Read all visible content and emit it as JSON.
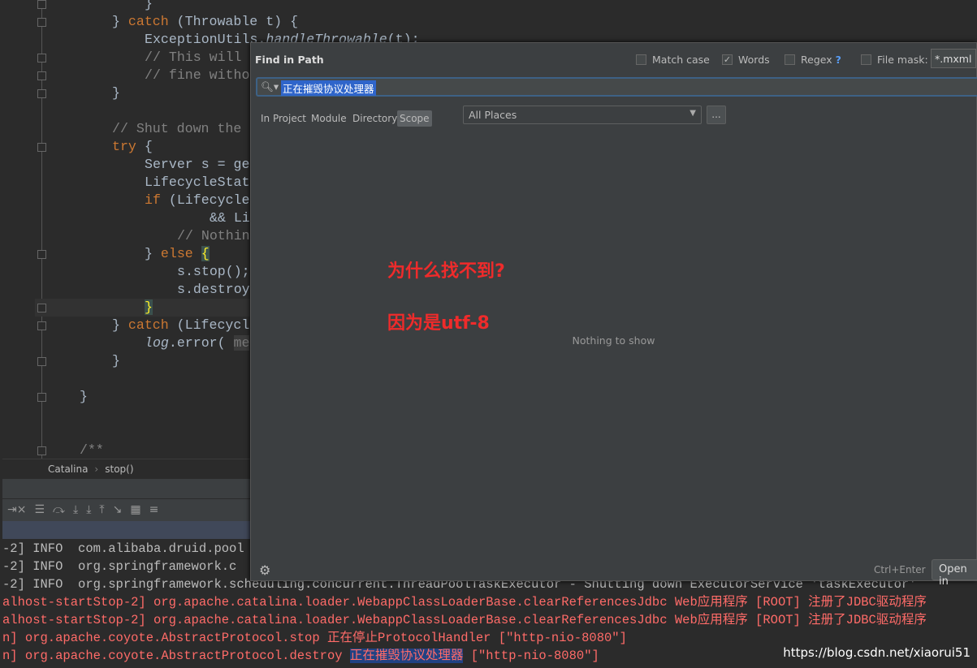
{
  "editor": {
    "lines": [
      {
        "indent": 8,
        "parts": [
          [
            "}",
            ""
          ]
        ]
      },
      {
        "indent": 4,
        "parts": [
          [
            "} ",
            ""
          ],
          [
            "catch",
            ".kw"
          ],
          [
            " (Throwable t) {",
            ""
          ]
        ]
      },
      {
        "indent": 8,
        "parts": [
          [
            "ExceptionUtils.",
            ""
          ],
          [
            "handleThrowable",
            ".it"
          ],
          [
            "(t);",
            ""
          ]
        ]
      },
      {
        "indent": 8,
        "parts": [
          [
            "// This will",
            ".cm"
          ]
        ]
      },
      {
        "indent": 8,
        "parts": [
          [
            "// fine witho",
            ".cm"
          ]
        ]
      },
      {
        "indent": 4,
        "parts": [
          [
            "}",
            ""
          ]
        ]
      },
      {
        "indent": 0,
        "parts": []
      },
      {
        "indent": 4,
        "parts": [
          [
            "// Shut down the",
            ".cm"
          ]
        ]
      },
      {
        "indent": 4,
        "parts": [
          [
            "try",
            ".kw"
          ],
          [
            " {",
            ""
          ]
        ]
      },
      {
        "indent": 8,
        "parts": [
          [
            "Server s = ge",
            ""
          ]
        ]
      },
      {
        "indent": 8,
        "parts": [
          [
            "LifecycleStat",
            ""
          ]
        ]
      },
      {
        "indent": 8,
        "parts": [
          [
            "if",
            ".kw"
          ],
          [
            " (Lifecycle",
            ""
          ]
        ]
      },
      {
        "indent": 16,
        "parts": [
          [
            "&& Li",
            ""
          ]
        ]
      },
      {
        "indent": 12,
        "parts": [
          [
            "// Nothin",
            ".cm"
          ]
        ]
      },
      {
        "indent": 8,
        "parts": [
          [
            "} ",
            ""
          ],
          [
            "else",
            ".kw"
          ],
          [
            " ",
            ""
          ],
          [
            "{",
            ".brace-match"
          ]
        ]
      },
      {
        "indent": 12,
        "parts": [
          [
            "s.stop();",
            ""
          ]
        ]
      },
      {
        "indent": 12,
        "parts": [
          [
            "s.destroy",
            ""
          ]
        ]
      },
      {
        "indent": 8,
        "parts": [
          [
            "}",
            ".brace-match"
          ]
        ],
        "current": true
      },
      {
        "indent": 4,
        "parts": [
          [
            "} ",
            ""
          ],
          [
            "catch",
            ".kw"
          ],
          [
            " (Lifecycl",
            ""
          ]
        ]
      },
      {
        "indent": 8,
        "parts": [
          [
            "log",
            ".it"
          ],
          [
            ".error( ",
            ""
          ],
          [
            "me",
            ".hint"
          ]
        ]
      },
      {
        "indent": 4,
        "parts": [
          [
            "}",
            ""
          ]
        ]
      },
      {
        "indent": 0,
        "parts": []
      },
      {
        "indent": 0,
        "parts": [
          [
            "}",
            ""
          ]
        ]
      },
      {
        "indent": 0,
        "parts": []
      },
      {
        "indent": 0,
        "parts": []
      },
      {
        "indent": 0,
        "parts": [
          [
            "/**",
            ".cm"
          ]
        ]
      }
    ]
  },
  "breadcrumb": [
    "Catalina",
    "›",
    "stop()"
  ],
  "toolbar_icons": [
    "pin-close-icon",
    "menu-icon",
    "step-over-icon",
    "step-into-icon",
    "force-step-into-icon",
    "step-out-icon",
    "run-to-cursor-icon",
    "evaluate-icon",
    "trace-icon"
  ],
  "console": [
    {
      "type": "info",
      "text": "-2] INFO  com.alibaba.druid.pool"
    },
    {
      "type": "info",
      "text": "-2] INFO  org.springframework.c"
    },
    {
      "type": "info",
      "text": "-2] INFO  org.springframework.scheduling.concurrent.ThreadPoolTaskExecutor - Shutting down ExecutorService 'taskExecutor'"
    },
    {
      "type": "err",
      "text": "alhost-startStop-2] org.apache.catalina.loader.WebappClassLoaderBase.clearReferencesJdbc Web应用程序 [ROOT] 注册了JDBC驱动程序"
    },
    {
      "type": "err",
      "text": "alhost-startStop-2] org.apache.catalina.loader.WebappClassLoaderBase.clearReferencesJdbc Web应用程序 [ROOT] 注册了JDBC驱动程序"
    },
    {
      "type": "err",
      "text": "n] org.apache.coyote.AbstractProtocol.stop 正在停止ProtocolHandler [\"http-nio-8080\"]"
    },
    {
      "type": "err",
      "pre": "n] org.apache.coyote.AbstractProtocol.destroy ",
      "sel": "正在摧毁协议处理器",
      "post": " [\"http-nio-8080\"]"
    }
  ],
  "dialog": {
    "title": "Find in Path",
    "match_case": {
      "label": "Match case",
      "checked": false
    },
    "words": {
      "label": "Words",
      "checked": true
    },
    "regex": {
      "label": "Regex",
      "checked": false,
      "help": "?"
    },
    "file_mask": {
      "label": "File mask:",
      "checked": false,
      "value": "*.mxml"
    },
    "search_value": "正在摧毁协议处理器",
    "scopes": [
      "In Project",
      "Module",
      "Directory",
      "Scope"
    ],
    "active_scope": "Scope",
    "places": "All Places",
    "dots": "...",
    "empty": "Nothing to show",
    "annotation1": "为什么找不到?",
    "annotation2": "因为是utf-8",
    "shortcut": "Ctrl+Enter",
    "open_button": "Open in"
  },
  "watermark": "https://blog.csdn.net/xiaorui51"
}
